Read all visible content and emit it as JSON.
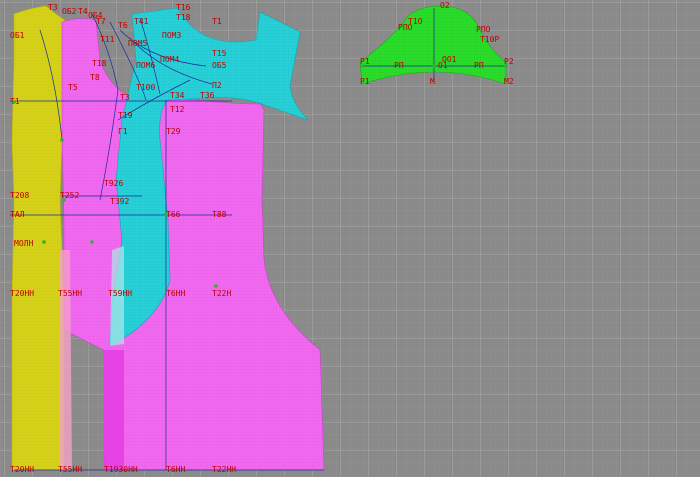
{
  "colors": {
    "background": "#8a8a8a",
    "grid": "#a0a0a0",
    "yellow": "#d6d21a",
    "magenta": "#f06af0",
    "magenta_dark": "#e43ce4",
    "cyan": "#28d0d8",
    "green": "#2bdc2b",
    "construction_line": "#1a2a9a",
    "label": "#c00000"
  },
  "sleeve_labels": {
    "o2": "O2",
    "rpo": "РПО",
    "t1o": "T1O",
    "rpo2": "РПО",
    "t10r": "T10Р",
    "p1": "P1",
    "rp": "РП",
    "o1": "О1",
    "rp2": "РП",
    "p2": "P2",
    "m": "М",
    "m2": "М2",
    "oo1": "ОО1"
  },
  "pattern_labels": {
    "t3": "Т3",
    "ob2": "ОБ2",
    "t4": "Т4",
    "ob4": "ОБ4",
    "t7": "Т7",
    "t6": "Т6",
    "t41": "Т41",
    "t16": "Т16",
    "t18": "Т18",
    "t1": "Т1",
    "ob1": "ОБ1",
    "t11": "Т11",
    "pom5": "ПОМ5",
    "pom3": "ПОМ3",
    "t15": "Т15",
    "pom4": "ПОМ4",
    "pom6": "ПОМ6",
    "ob5": "ОБ5",
    "t18b": "Т18",
    "t8": "Т8",
    "t5": "Т5",
    "p2": "П2",
    "t100": "Т100",
    "t3a": "Т3",
    "t34": "Т34",
    "t36": "Т36",
    "t1b": "Т1",
    "t19": "Т19",
    "t12": "Т12",
    "t29": "Т29",
    "g1": "Г1",
    "t208": "Т208",
    "t252": "Т252",
    "t926": "Т926",
    "t392": "Т392",
    "tal": "ТАЛ",
    "t66": "Т66",
    "t88": "Т88",
    "moln": "МОЛН",
    "t20n": "Т20НН",
    "t55n": "Т55НН",
    "t59n": "Т59НН",
    "t6h": "Т6НН",
    "t22h": "Т22Н",
    "t20nn": "Т20НН",
    "t55nn": "Т55НН",
    "t1930": "Т1930НН",
    "t6nn": "Т6НН",
    "t22nn": "Т22НН"
  }
}
